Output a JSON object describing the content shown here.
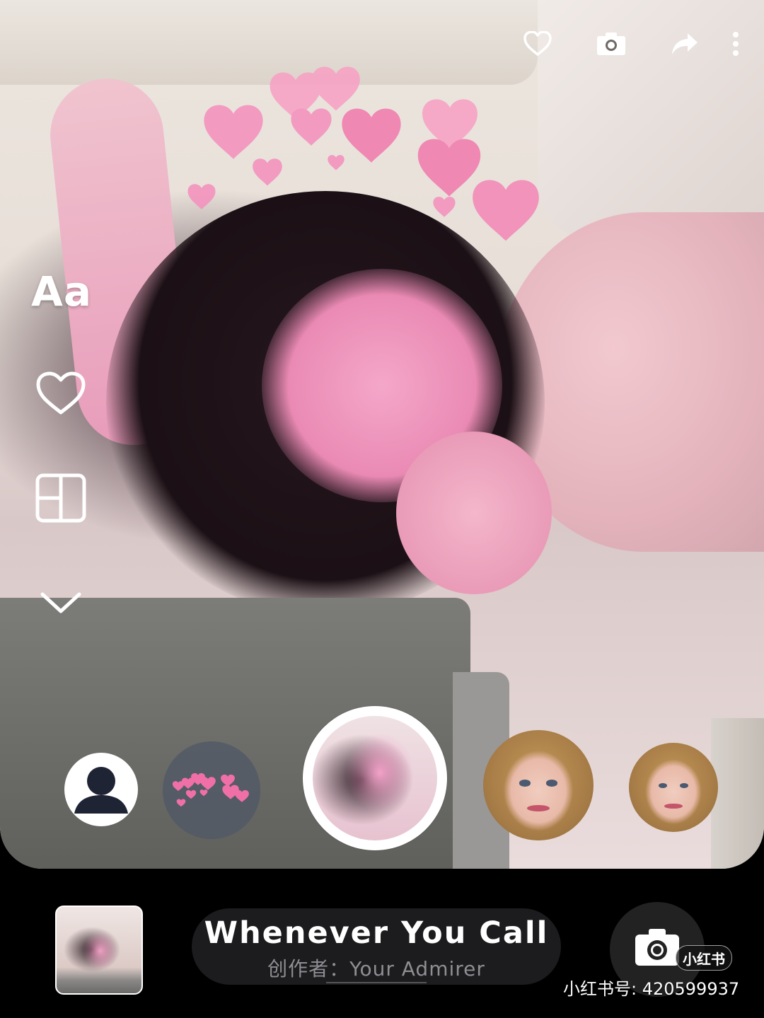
{
  "top_toolbar": {
    "icons": [
      "heart-outline-icon",
      "camera-icon",
      "share-icon",
      "more-vertical-icon"
    ]
  },
  "left_tools": {
    "text_tool_label": "Aa",
    "icons": [
      "heart-outline-icon",
      "layout-icon",
      "chevron-down-icon"
    ]
  },
  "filter_carousel": {
    "items": [
      "avatar-silhouette",
      "pink-hearts",
      "selected-photo",
      "portrait-filter",
      "portrait-filter"
    ],
    "selected_index": 2
  },
  "bottom_bar": {
    "music": {
      "title": "Whenever You Call",
      "author": "创作者：Your Admirer"
    },
    "capture_icon": "camera-icon"
  },
  "watermark": {
    "badge": "小红书",
    "account": "小红书号: 420599937"
  },
  "colors": {
    "accent_pink": "#f28bb7",
    "pill_bg": "#1c1c1e",
    "author_text": "#8e8e93"
  }
}
